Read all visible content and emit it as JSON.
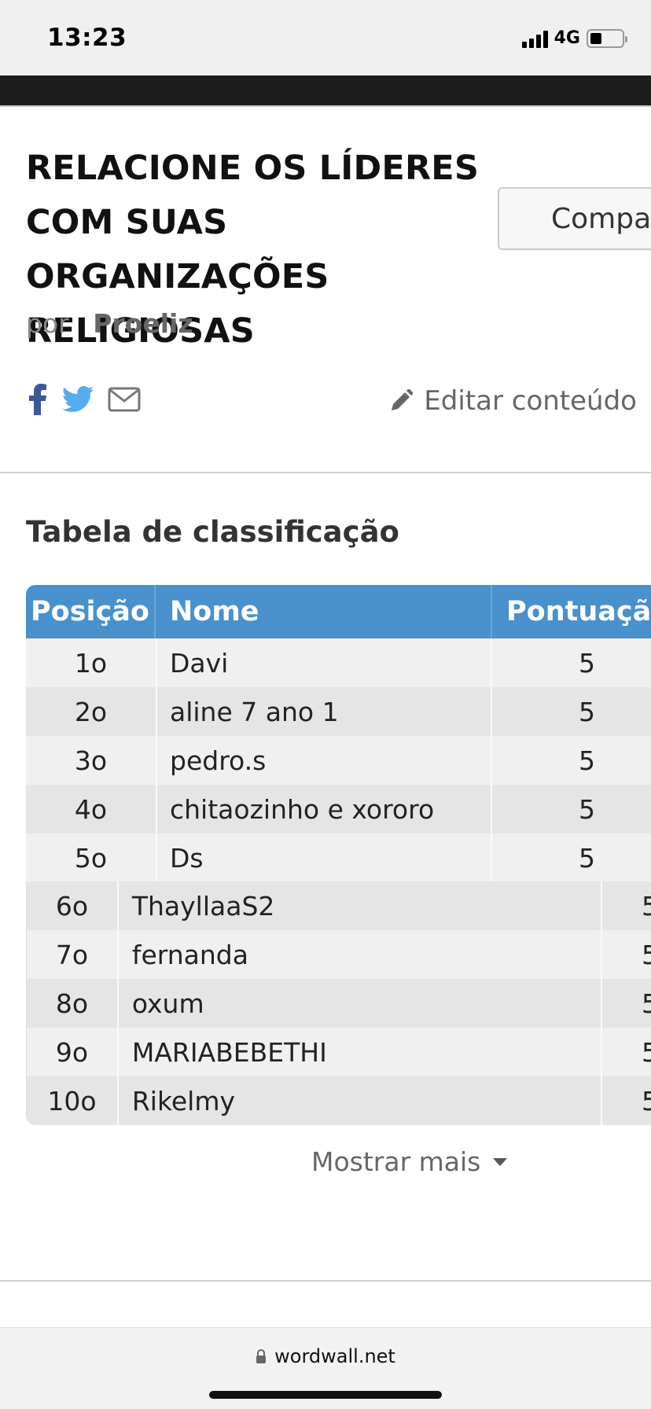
{
  "status_bar": {
    "time": "13:23",
    "network": "4G"
  },
  "page": {
    "title_lines": [
      "RELACIONE OS LÍDERES",
      "COM SUAS ORGANIZAÇÕES",
      "RELIGIOSAS"
    ],
    "share_button_label": "Compartilhar",
    "author_prefix": "por",
    "author_name": "Proeliz",
    "edit_label": "Editar conteúdo",
    "social_icons": [
      "facebook-icon",
      "twitter-icon",
      "email-icon"
    ]
  },
  "leaderboard": {
    "title": "Tabela de classificação",
    "headers": {
      "position": "Posição",
      "name": "Nome",
      "score": "Pontuação"
    },
    "rows": [
      {
        "position": "1o",
        "name": "Davi",
        "score": "5"
      },
      {
        "position": "2o",
        "name": "aline 7 ano 1",
        "score": "5"
      },
      {
        "position": "3o",
        "name": "pedro.s",
        "score": "5"
      },
      {
        "position": "4o",
        "name": "chitaozinho e xororo",
        "score": "5"
      },
      {
        "position": "5o",
        "name": "Ds",
        "score": "5"
      },
      {
        "position": "6o",
        "name": "ThayllaaS2",
        "score": "5"
      },
      {
        "position": "7o",
        "name": "fernanda",
        "score": "5"
      },
      {
        "position": "8o",
        "name": "oxum",
        "score": "5"
      },
      {
        "position": "9o",
        "name": "MARIABEBETHI",
        "score": "5"
      },
      {
        "position": "10o",
        "name": "Rikelmy",
        "score": "5"
      }
    ],
    "show_more_label": "Mostrar mais"
  },
  "browser": {
    "url": "wordwall.net"
  },
  "colors": {
    "table_header": "#4891cd",
    "dark_strip": "#1c1c1c"
  }
}
